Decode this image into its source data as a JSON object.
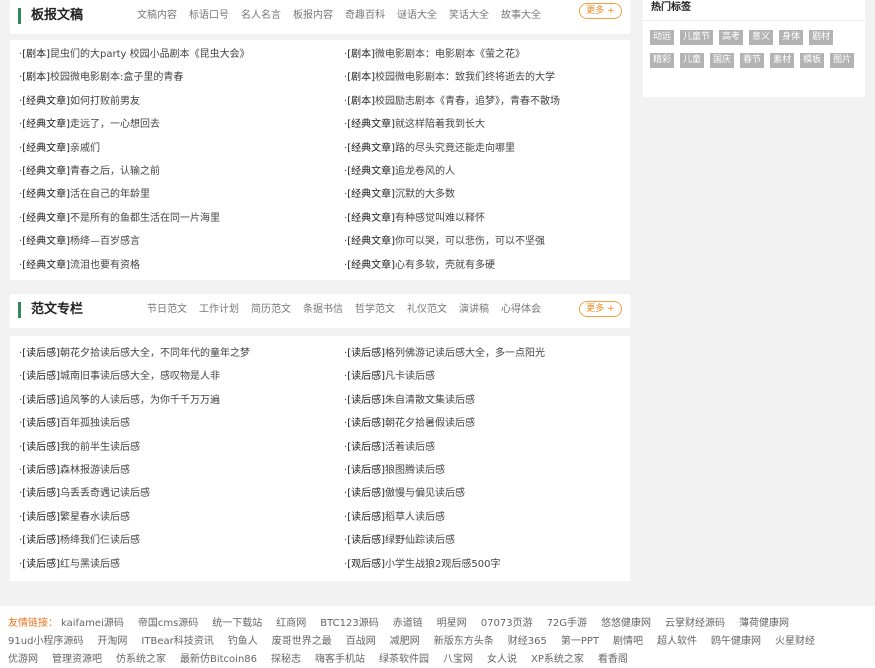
{
  "section1": {
    "title": "板报文稿",
    "tabs": [
      "文稿内容",
      "标语口号",
      "名人名言",
      "板报内容",
      "奇趣百科",
      "谜语大全",
      "笑话大全",
      "故事大全"
    ],
    "more": "更多 +",
    "left": [
      {
        "tag": "[剧本]",
        "text": "昆虫们的大party 校园小品剧本《昆虫大会》"
      },
      {
        "tag": "[剧本]",
        "text": "校园微电影剧本:盒子里的青春"
      },
      {
        "tag": "[经典文章]",
        "text": "如何打败前男友"
      },
      {
        "tag": "[经典文章]",
        "text": "走远了，一心想回去"
      },
      {
        "tag": "[经典文章]",
        "text": "亲戚们"
      },
      {
        "tag": "[经典文章]",
        "text": "青春之后，认输之前"
      },
      {
        "tag": "[经典文章]",
        "text": "活在自己的年龄里"
      },
      {
        "tag": "[经典文章]",
        "text": "不是所有的鱼都生活在同一片海里"
      },
      {
        "tag": "[经典文章]",
        "text": "杨绛—百岁感言"
      },
      {
        "tag": "[经典文章]",
        "text": "流泪也要有资格"
      }
    ],
    "right": [
      {
        "tag": "[剧本]",
        "text": "微电影剧本：电影剧本《萤之花》"
      },
      {
        "tag": "[剧本]",
        "text": "校园微电影剧本：致我们终将逝去的大学"
      },
      {
        "tag": "[剧本]",
        "text": "校园励志剧本《青春，追梦》，青春不散场"
      },
      {
        "tag": "[经典文章]",
        "text": "就这样陪着我到长大"
      },
      {
        "tag": "[经典文章]",
        "text": "路的尽头究竟还能走向哪里"
      },
      {
        "tag": "[经典文章]",
        "text": "追龙卷风的人"
      },
      {
        "tag": "[经典文章]",
        "text": "沉默的大多数"
      },
      {
        "tag": "[经典文章]",
        "text": "有种感觉叫难以释怀"
      },
      {
        "tag": "[经典文章]",
        "text": "你可以哭，可以悲伤，可以不坚强"
      },
      {
        "tag": "[经典文章]",
        "text": "心有多软，壳就有多硬"
      }
    ]
  },
  "section2": {
    "title": "范文专栏",
    "tabs": [
      "节日范文",
      "工作计划",
      "简历范文",
      "条据书信",
      "哲学范文",
      "礼仪范文",
      "演讲稿",
      "心得体会"
    ],
    "more": "更多 +",
    "left": [
      {
        "tag": "[读后感]",
        "text": "朝花夕拾读后感大全，不同年代的童年之梦"
      },
      {
        "tag": "[读后感]",
        "text": "城南旧事读后感大全，感叹物是人非"
      },
      {
        "tag": "[读后感]",
        "text": "追风筝的人读后感，为你千千万万遍"
      },
      {
        "tag": "[读后感]",
        "text": "百年孤独读后感"
      },
      {
        "tag": "[读后感]",
        "text": "我的前半生读后感"
      },
      {
        "tag": "[读后感]",
        "text": "森林报游读后感"
      },
      {
        "tag": "[读后感]",
        "text": "乌丢丢奇遇记读后感"
      },
      {
        "tag": "[读后感]",
        "text": "繁星春水读后感"
      },
      {
        "tag": "[读后感]",
        "text": "杨绛我们仨读后感"
      },
      {
        "tag": "[读后感]",
        "text": "红与黑读后感"
      }
    ],
    "right": [
      {
        "tag": "[读后感]",
        "text": "格列佛游记读后感大全，多一点阳光"
      },
      {
        "tag": "[读后感]",
        "text": "凡卡读后感"
      },
      {
        "tag": "[读后感]",
        "text": "朱自清散文集读后感"
      },
      {
        "tag": "[读后感]",
        "text": "朝花夕拾暑假读后感"
      },
      {
        "tag": "[读后感]",
        "text": "活着读后感"
      },
      {
        "tag": "[读后感]",
        "text": "狼图腾读后感"
      },
      {
        "tag": "[读后感]",
        "text": "傲慢与偏见读后感"
      },
      {
        "tag": "[读后感]",
        "text": "稻草人读后感"
      },
      {
        "tag": "[读后感]",
        "text": "绿野仙踪读后感"
      },
      {
        "tag": "[观后感]",
        "text": "小学生战狼2观后感500字"
      }
    ]
  },
  "hot_tags": {
    "title": "热门标签",
    "tags": [
      "动远",
      "儿童节",
      "高考",
      "意义",
      "身体",
      "剧材",
      "精彩",
      "儿童",
      "国庆",
      "春节",
      "素材",
      "模板",
      "图片"
    ]
  },
  "footer": {
    "label": "友情链接：",
    "links": [
      "kaifamei源码",
      "帝国cms源码",
      "统一下载站",
      "红商网",
      "BTC123源码",
      "赤道链",
      "明星网",
      "07073页游",
      "72G手游",
      "悠悠健康网",
      "云掌财经源码",
      "薄荷健康网",
      "91ud小程序源码",
      "开淘网",
      "ITBear科技资讯",
      "钓鱼人",
      "废哥世界之最",
      "百战网",
      "减肥网",
      "新版东方头条",
      "财经365",
      "第一PPT",
      "剧情吧",
      "超人软件",
      "鸥午健康网",
      "火星财经",
      "优游网",
      "管理资源吧",
      "仿系统之家",
      "最新仿Bitcoin86",
      "探秘志",
      "嗨客手机站",
      "绿茶软件园",
      "八宝网",
      "女人说",
      "XP系统之家",
      "看香阁"
    ]
  }
}
